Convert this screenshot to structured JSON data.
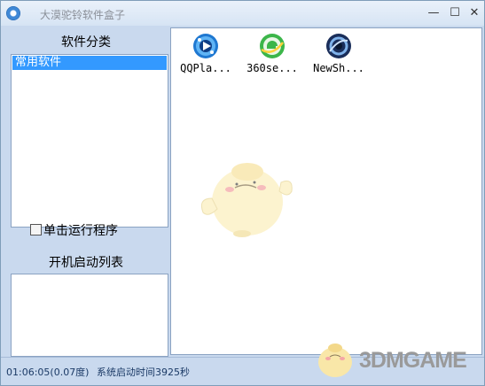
{
  "window": {
    "title": "大漠驼铃软件盒子",
    "controls": {
      "minimize": "—",
      "maximize": "☐",
      "close": "✕"
    }
  },
  "left_panel": {
    "category_heading": "软件分类",
    "categories": [
      {
        "label": "常用软件",
        "selected": true
      }
    ],
    "single_click_checkbox": {
      "label": "单击运行程序",
      "checked": false
    },
    "boot_heading": "开机启动列表",
    "boot_items": []
  },
  "apps": [
    {
      "label": "QQPla...",
      "icon": "qqplayer-icon",
      "color": "#1f78d1"
    },
    {
      "label": "360se...",
      "icon": "360-browser-icon",
      "color": "#3cb64a"
    },
    {
      "label": "NewSh...",
      "icon": "newsh-icon",
      "color": "#1a2e5a"
    }
  ],
  "status": {
    "time": "01:06:05(0.07度)",
    "boot_time": "系统启动时间3925秒"
  },
  "watermark": {
    "text": "3DMGAME"
  }
}
